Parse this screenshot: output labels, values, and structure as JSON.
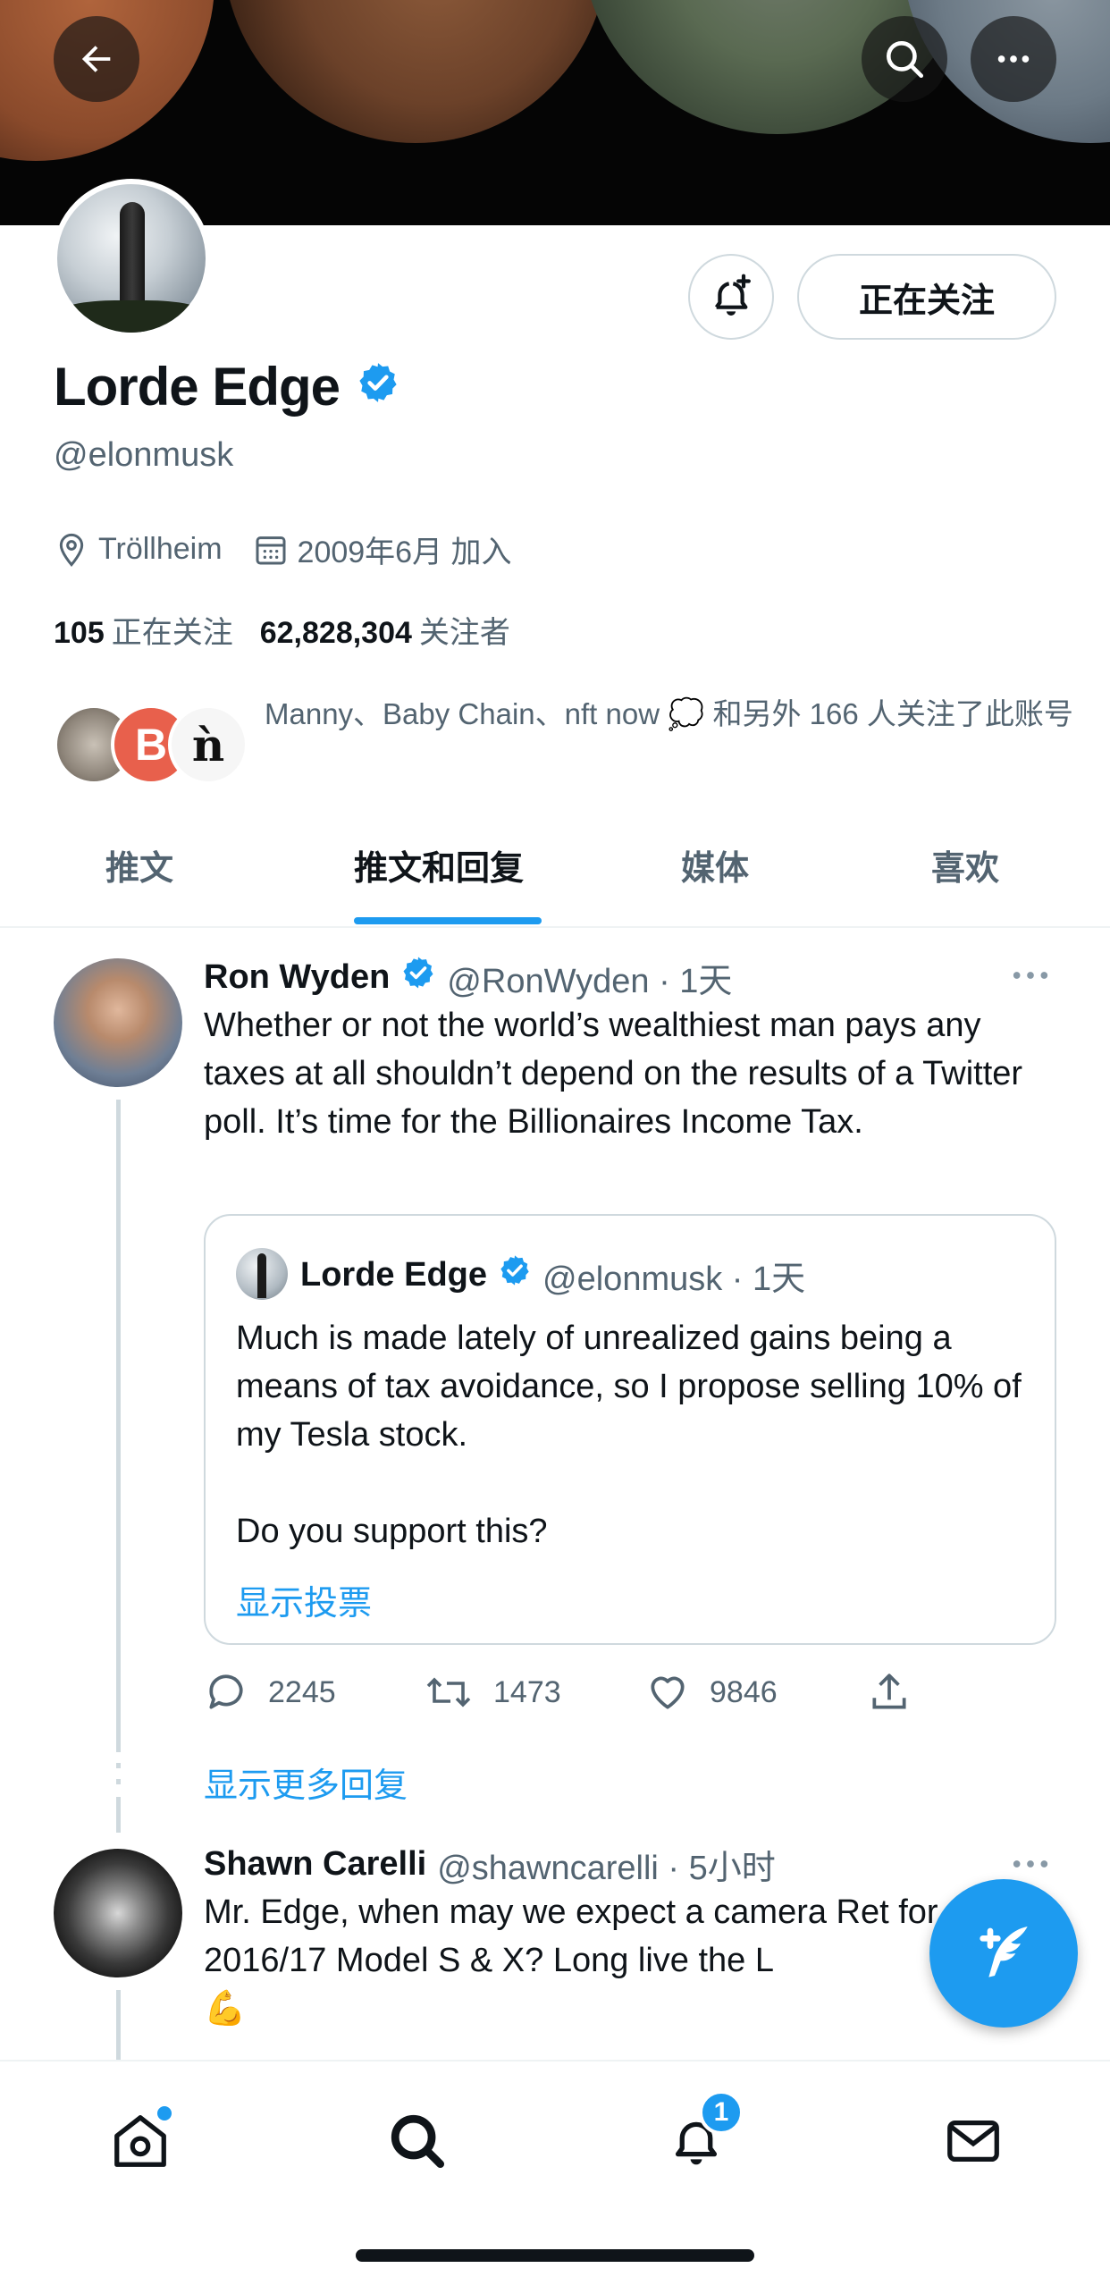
{
  "profile": {
    "name": "Lorde Edge",
    "handle": "@elonmusk",
    "location": "Tröllheim",
    "joined": "2009年6月 加入",
    "following_count": "105",
    "following_label": "正在关注",
    "followers_count": "62,828,304",
    "followers_label": "关注者",
    "follow_button": "正在关注",
    "followers_you_know": "Manny、Baby Chain、nft now 💭 和另外 166 人关注了此账号"
  },
  "tabs": [
    {
      "label": "推文"
    },
    {
      "label": "推文和回复"
    },
    {
      "label": "媒体"
    },
    {
      "label": "喜欢"
    }
  ],
  "tweets": [
    {
      "name": "Ron Wyden",
      "handle": "@RonWyden · 1天",
      "text": "Whether or not the world’s wealthiest man pays any taxes at all shouldn’t depend on the results of a Twitter poll. It’s time for the Billionaires Income Tax.",
      "quote": {
        "name": "Lorde Edge",
        "handle": "@elonmusk · 1天",
        "text": "Much is made lately of unrealized gains being a means of tax avoidance, so I propose selling 10% of my Tesla stock.\n\nDo you support this?",
        "link": "显示投票"
      },
      "replies": "2245",
      "retweets": "1473",
      "likes": "9846",
      "show_more": "显示更多回复"
    },
    {
      "name": "Shawn Carelli",
      "handle": "@shawncarelli · 5小时",
      "text": "Mr. Edge, when may we expect a camera Ret for our 2016/17 Model S & X? Long live the L",
      "emoji": "💪"
    }
  ],
  "nav": {
    "notifications_badge": "1"
  },
  "colors": {
    "accent": "#1d9bf0",
    "text": "#0f1419",
    "secondary": "#536471"
  }
}
